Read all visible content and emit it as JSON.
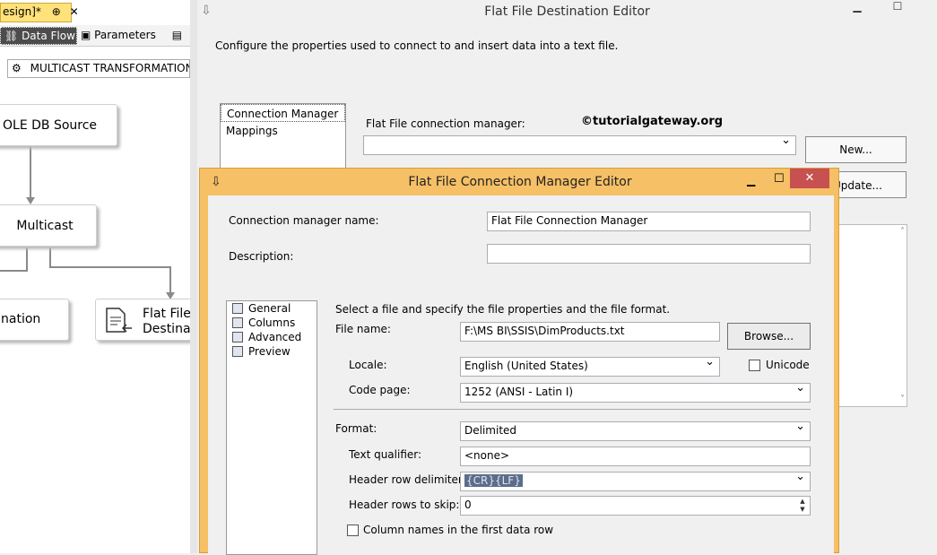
{
  "designer": {
    "doc_tab": "esign]*",
    "doc_tab_pin": "⊕",
    "doc_tab_close": "✕",
    "tabs": {
      "data_flow": "Data Flow",
      "parameters": "Parameters"
    },
    "task_selector": "MULTICAST TRANSFORMATION",
    "nodes": {
      "source": "OLE DB Source",
      "multicast": "Multicast",
      "dest1": "nation",
      "dest2_line1": "Flat File",
      "dest2_line2": "Destinat"
    }
  },
  "outer_editor": {
    "title": "Flat File Destination Editor",
    "description": "Configure the properties used to connect to and insert data into a text file.",
    "nav": [
      "Connection Manager",
      "Mappings"
    ],
    "connection_manager_label": "Flat File connection manager:",
    "watermark": "©tutorialgateway.org",
    "new_button": "New...",
    "update_button": "Update..."
  },
  "inner_dialog": {
    "title": "Flat File Connection Manager Editor",
    "cm_name_label": "Connection manager name:",
    "cm_name_value": "Flat File Connection Manager",
    "description_label": "Description:",
    "description_value": "",
    "nav": [
      {
        "label": "General",
        "icon": "general-icon"
      },
      {
        "label": "Columns",
        "icon": "columns-icon"
      },
      {
        "label": "Advanced",
        "icon": "advanced-icon"
      },
      {
        "label": "Preview",
        "icon": "preview-icon"
      }
    ],
    "instructions": "Select a file and specify the file properties and the file format.",
    "file_name_label": "File name:",
    "file_name_value": "F:\\MS BI\\SSIS\\DimProducts.txt",
    "browse_button": "Browse...",
    "locale_label": "Locale:",
    "locale_value": "English (United States)",
    "unicode_label": "Unicode",
    "code_page_label": "Code page:",
    "code_page_value": "1252  (ANSI - Latin I)",
    "format_label": "Format:",
    "format_value": "Delimited",
    "text_qualifier_label": "Text qualifier:",
    "text_qualifier_value": "<none>",
    "header_row_delimiter_label": "Header row delimiter:",
    "header_row_delimiter_value": "{CR}{LF}",
    "header_rows_skip_label": "Header rows to skip:",
    "header_rows_skip_value": "0",
    "column_names_label": "Column names in the first data row"
  },
  "colors": {
    "accent": "#f6c066",
    "dataflow_tab": "#4c4c4c",
    "doc_tab": "#ffe27a"
  }
}
